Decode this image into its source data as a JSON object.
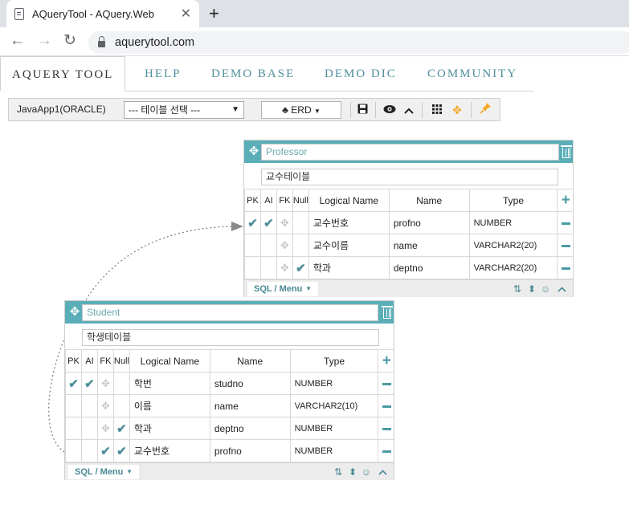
{
  "browser": {
    "tab_title": "AQueryTool - AQuery.Web",
    "url": "aquerytool.com"
  },
  "nav": {
    "tabs": [
      "AQUERY TOOL",
      "HELP",
      "DEMO BASE",
      "DEMO DIC",
      "COMMUNITY"
    ],
    "active": "AQUERY TOOL"
  },
  "toolbar": {
    "connection": "JavaApp1(ORACLE)",
    "table_select": "--- 테이블 선택 ---",
    "erd_label": "ERD",
    "highlight_color": "#f5a623"
  },
  "colors": {
    "header": "#5aaeb8",
    "accent": "#4f8f9a"
  },
  "tables": {
    "professor": {
      "name": "Professor",
      "comment": "교수테이블",
      "columns": [
        "PK",
        "AI",
        "FK",
        "Null",
        "Logical Name",
        "Name",
        "Type"
      ],
      "rows": [
        {
          "pk": true,
          "ai": true,
          "fk_icon": true,
          "null": false,
          "logical": "교수번호",
          "name": "profno",
          "type": "NUMBER"
        },
        {
          "pk": false,
          "ai": false,
          "fk_icon": true,
          "null": false,
          "logical": "교수이름",
          "name": "name",
          "type": "VARCHAR2(20)"
        },
        {
          "pk": false,
          "ai": false,
          "fk_icon": true,
          "null": true,
          "logical": "학과",
          "name": "deptno",
          "type": "VARCHAR2(20)"
        }
      ],
      "footer_menu": "SQL / Menu"
    },
    "student": {
      "name": "Student",
      "comment": "학생테이블",
      "columns": [
        "PK",
        "AI",
        "FK",
        "Null",
        "Logical Name",
        "Name",
        "Type"
      ],
      "rows": [
        {
          "pk": true,
          "ai": true,
          "fk_icon": true,
          "null": false,
          "logical": "학번",
          "name": "studno",
          "type": "NUMBER"
        },
        {
          "pk": false,
          "ai": false,
          "fk_icon": true,
          "null": false,
          "logical": "이름",
          "name": "name",
          "type": "VARCHAR2(10)"
        },
        {
          "pk": false,
          "ai": false,
          "fk_icon": true,
          "null": true,
          "logical": "학과",
          "name": "deptno",
          "type": "NUMBER"
        },
        {
          "pk": false,
          "ai": false,
          "fk": true,
          "null": true,
          "logical": "교수번호",
          "name": "profno",
          "type": "NUMBER"
        }
      ],
      "footer_menu": "SQL / Menu"
    }
  }
}
